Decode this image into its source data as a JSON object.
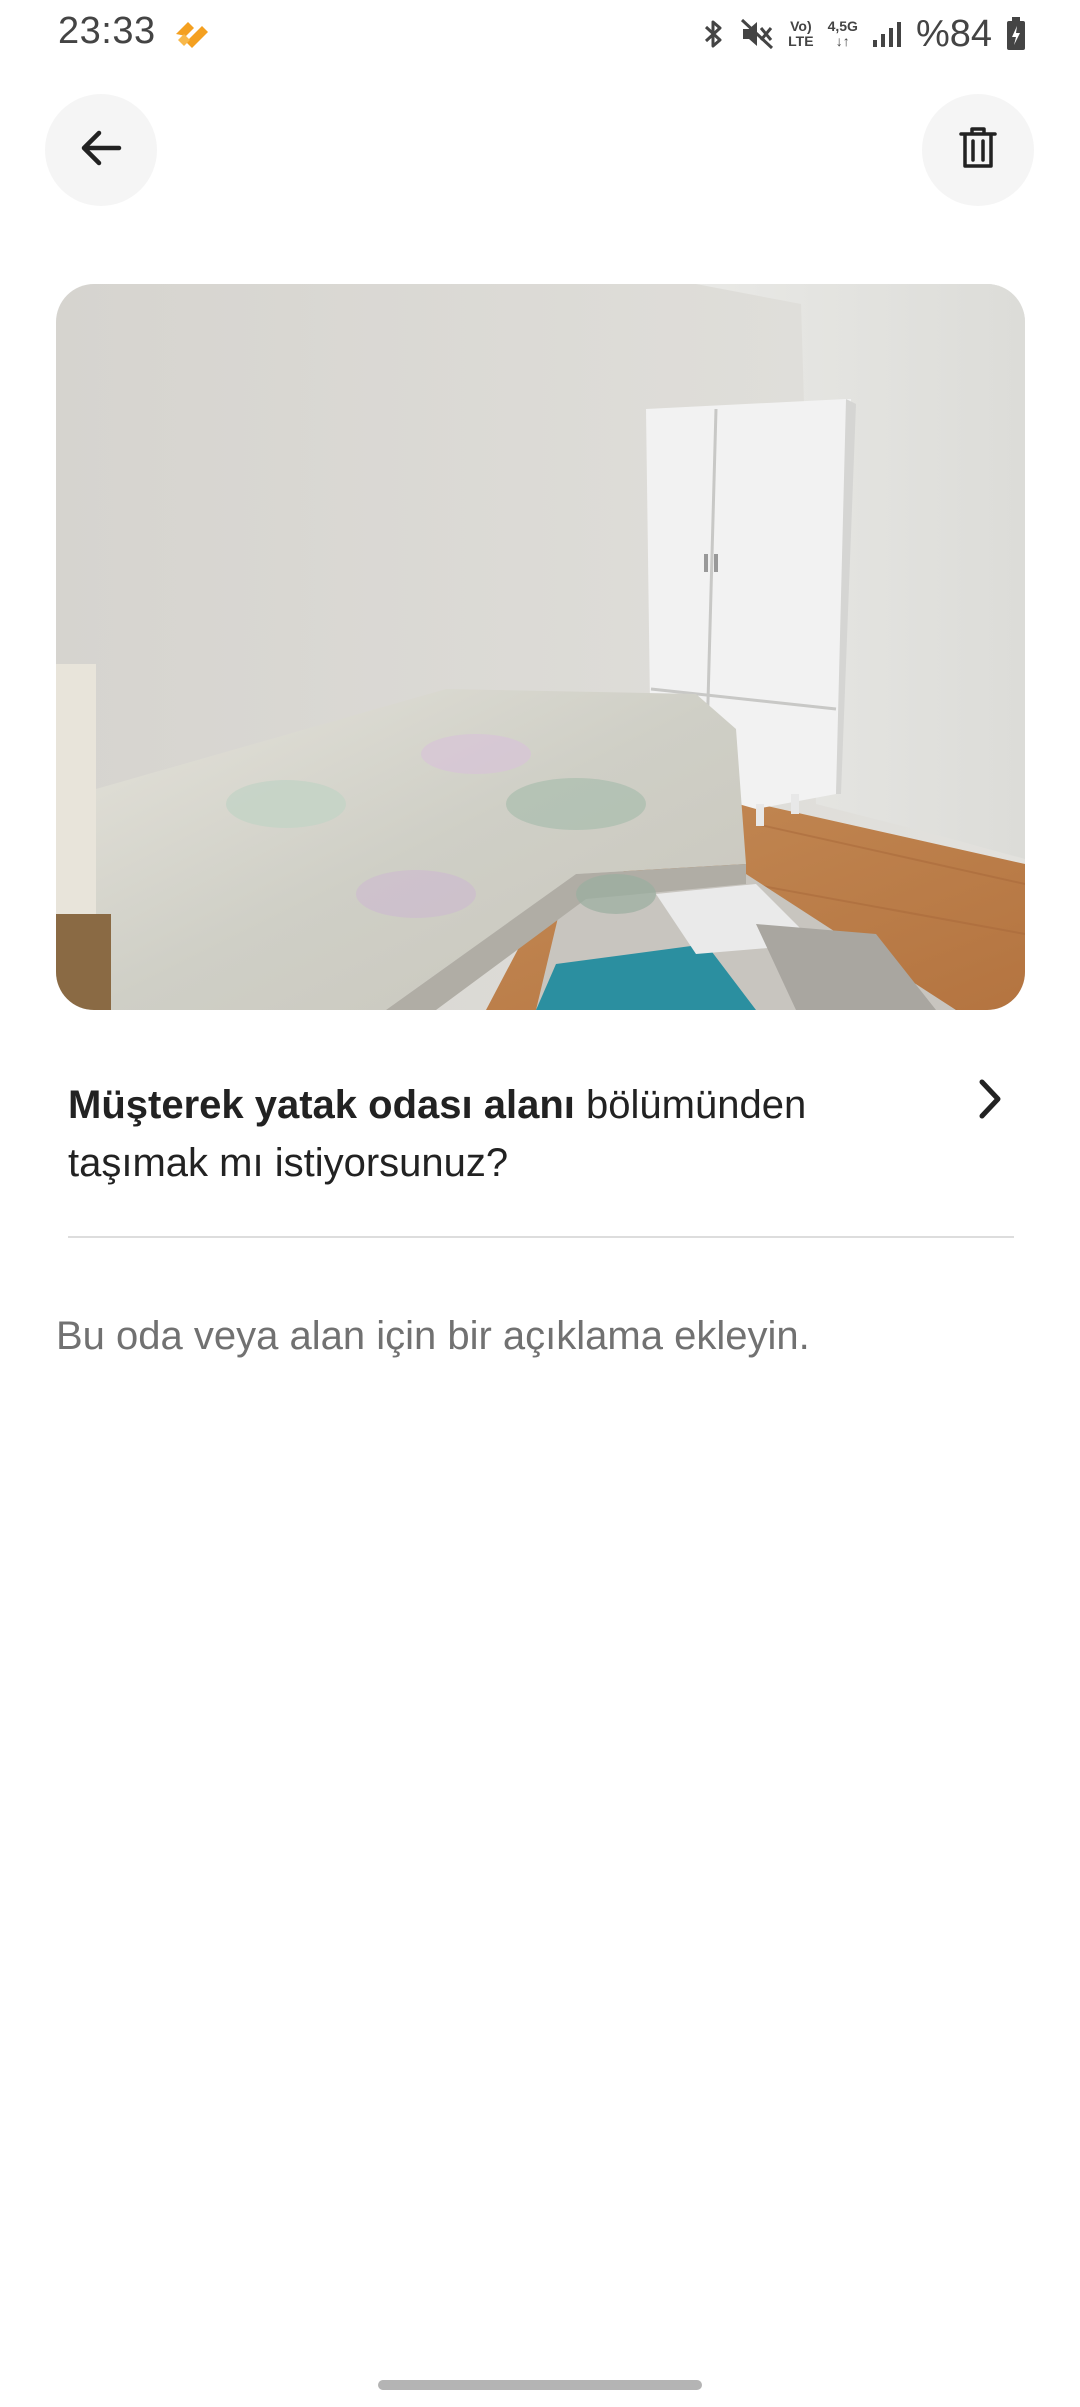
{
  "status_bar": {
    "time": "23:33",
    "network_top": "Vo)",
    "network_bottom": "LTE",
    "data_top": "4,5G",
    "data_bottom": "↓↑",
    "battery": "%84",
    "icons": [
      "app-notification-icon",
      "bluetooth-icon",
      "mute-icon",
      "volte-icon",
      "data-icon",
      "signal-icon",
      "battery-icon"
    ]
  },
  "header": {
    "back_icon": "arrow-left-icon",
    "delete_icon": "trash-icon"
  },
  "photo": {
    "description": "room photo"
  },
  "move_prompt": {
    "bold": "Müşterek yatak odası alanı",
    "rest": " bölümünden taşımak mı istiyorsunuz?",
    "icon": "chevron-right-icon"
  },
  "description": {
    "placeholder": "Bu oda veya alan için bir açıklama ekleyin.",
    "value": ""
  },
  "colors": {
    "background": "#ffffff",
    "text_primary": "#222222",
    "text_secondary": "#717171",
    "button_bg": "#f5f5f5",
    "divider": "#dddddd",
    "app_icon": "#f4a020"
  }
}
